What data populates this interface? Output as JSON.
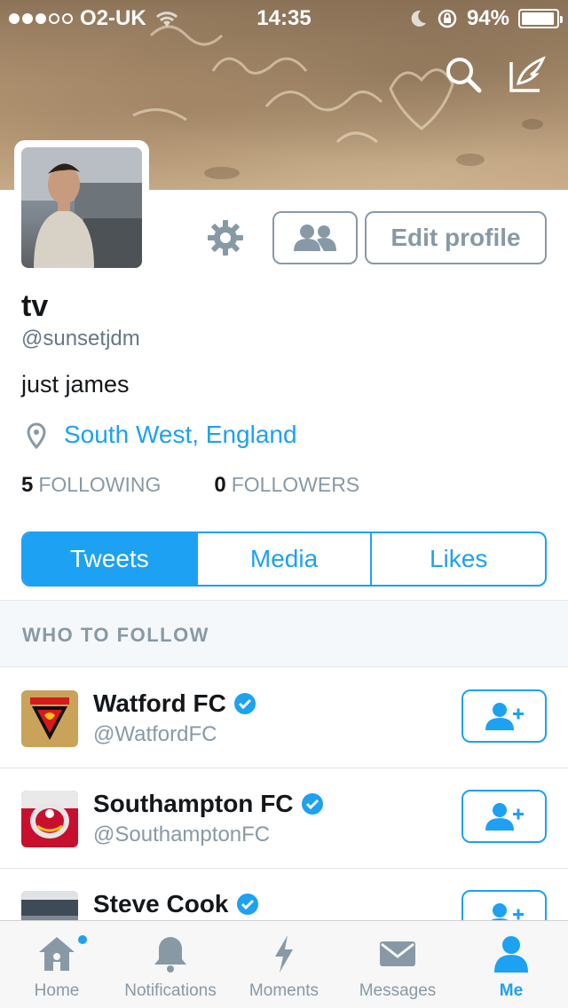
{
  "status_bar": {
    "carrier": "O2-UK",
    "time": "14:35",
    "battery": "94%",
    "battery_level": 0.94,
    "signal_dots_filled": 3,
    "signal_dots_total": 5
  },
  "profile": {
    "name": "tv",
    "handle": "@sunsetjdm",
    "bio": "just james",
    "location": "South West, England",
    "following_count": "5",
    "following_label": "FOLLOWING",
    "followers_count": "0",
    "followers_label": "FOLLOWERS",
    "edit_profile_label": "Edit profile"
  },
  "profile_tabs": [
    {
      "label": "Tweets",
      "active": true
    },
    {
      "label": "Media",
      "active": false
    },
    {
      "label": "Likes",
      "active": false
    }
  ],
  "who_to_follow": {
    "header": "WHO TO FOLLOW",
    "accounts": [
      {
        "name": "Watford FC",
        "handle": "@WatfordFC",
        "verified": true
      },
      {
        "name": "Southampton FC",
        "handle": "@SouthamptonFC",
        "verified": true
      },
      {
        "name": "Steve Cook",
        "handle": "",
        "verified": true
      }
    ]
  },
  "tab_bar": [
    {
      "label": "Home",
      "icon": "home-icon",
      "active": false,
      "badge": true
    },
    {
      "label": "Notifications",
      "icon": "bell-icon",
      "active": false
    },
    {
      "label": "Moments",
      "icon": "lightning-icon",
      "active": false
    },
    {
      "label": "Messages",
      "icon": "envelope-icon",
      "active": false
    },
    {
      "label": "Me",
      "icon": "person-icon",
      "active": true
    }
  ],
  "colors": {
    "accent": "#1da1f2",
    "muted": "#8899a6",
    "text": "#14171a"
  }
}
